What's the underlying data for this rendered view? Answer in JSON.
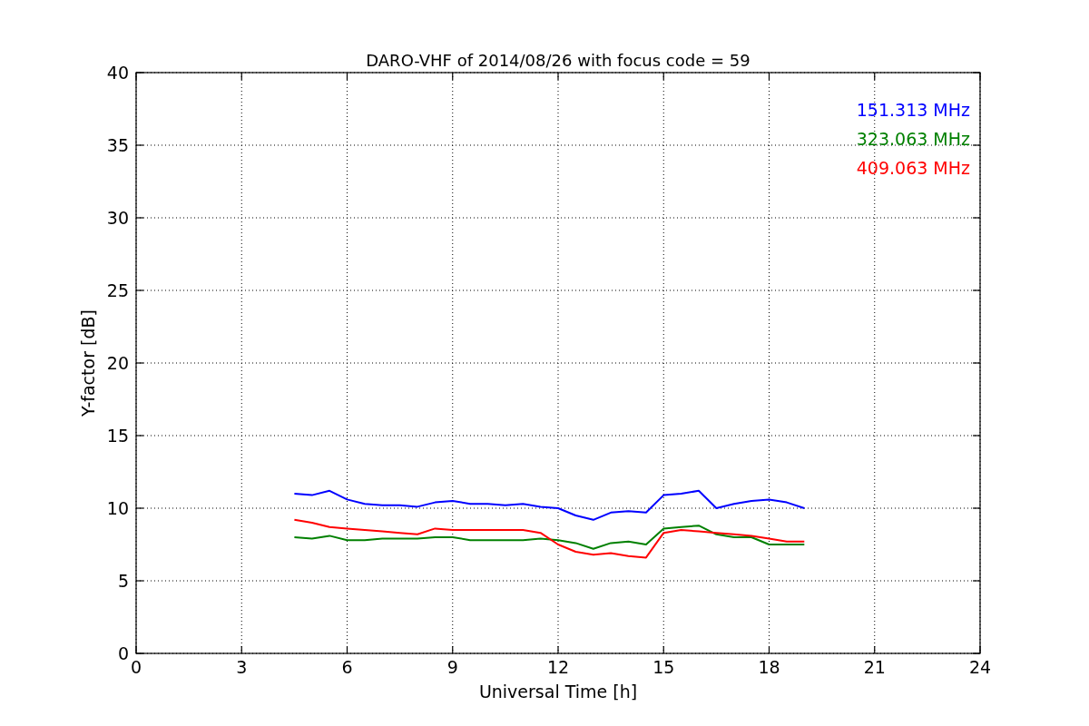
{
  "chart_data": {
    "type": "line",
    "title": "DARO-VHF of 2014/08/26 with focus code = 59",
    "xlabel": "Universal Time [h]",
    "ylabel": "Y-factor [dB]",
    "x": [
      4.5,
      5,
      5.5,
      6,
      6.5,
      7,
      7.5,
      8,
      8.5,
      9,
      9.5,
      10,
      10.5,
      11,
      11.5,
      12,
      12.5,
      13,
      13.5,
      14,
      14.5,
      15,
      15.5,
      16,
      16.5,
      17,
      17.5,
      18,
      18.5,
      19
    ],
    "series": [
      {
        "name": "151.313 MHz",
        "color": "#0000ff",
        "values": [
          11.0,
          10.9,
          11.2,
          10.6,
          10.3,
          10.2,
          10.2,
          10.1,
          10.4,
          10.5,
          10.3,
          10.3,
          10.2,
          10.3,
          10.1,
          10.0,
          9.5,
          9.2,
          9.7,
          9.8,
          9.7,
          10.9,
          11.0,
          11.2,
          10.0,
          10.3,
          10.5,
          10.6,
          10.4,
          10.0
        ]
      },
      {
        "name": "323.063 MHz",
        "color": "#008000",
        "values": [
          8.0,
          7.9,
          8.1,
          7.8,
          7.8,
          7.9,
          7.9,
          7.9,
          8.0,
          8.0,
          7.8,
          7.8,
          7.8,
          7.8,
          7.9,
          7.8,
          7.6,
          7.2,
          7.6,
          7.7,
          7.5,
          8.6,
          8.7,
          8.8,
          8.2,
          8.0,
          8.0,
          7.5,
          7.5,
          7.5
        ]
      },
      {
        "name": "409.063 MHz",
        "color": "#ff0000",
        "values": [
          9.2,
          9.0,
          8.7,
          8.6,
          8.5,
          8.4,
          8.3,
          8.2,
          8.6,
          8.5,
          8.5,
          8.5,
          8.5,
          8.5,
          8.3,
          7.5,
          7.0,
          6.8,
          6.9,
          6.7,
          6.6,
          8.3,
          8.5,
          8.4,
          8.3,
          8.2,
          8.1,
          7.9,
          7.7,
          7.7
        ]
      }
    ],
    "grid": true,
    "xlim": [
      0,
      24
    ],
    "ylim": [
      0,
      40
    ],
    "xticks": [
      0,
      3,
      6,
      9,
      12,
      15,
      18,
      21,
      24
    ],
    "yticks": [
      0,
      5,
      10,
      15,
      20,
      25,
      30,
      35,
      40
    ]
  }
}
